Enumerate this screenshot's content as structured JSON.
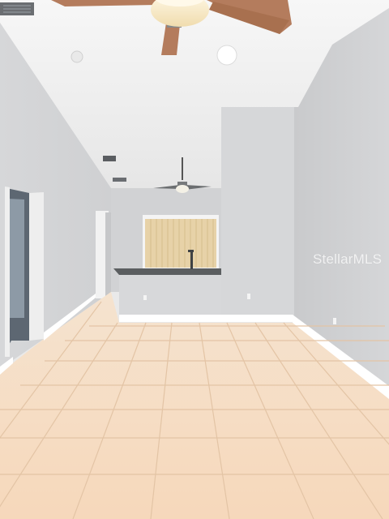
{
  "photo": {
    "watermark": "StellarMLS",
    "colors": {
      "ceiling": "#f2f2f2",
      "wall": "#d8d9db",
      "baseboard": "#ffffff",
      "tile": "#f3d8bc",
      "grout": "#e2c2a2",
      "counter": "#5b5e60",
      "blind": "#e7d2a8",
      "fan_blade": "#b47c5d"
    }
  }
}
